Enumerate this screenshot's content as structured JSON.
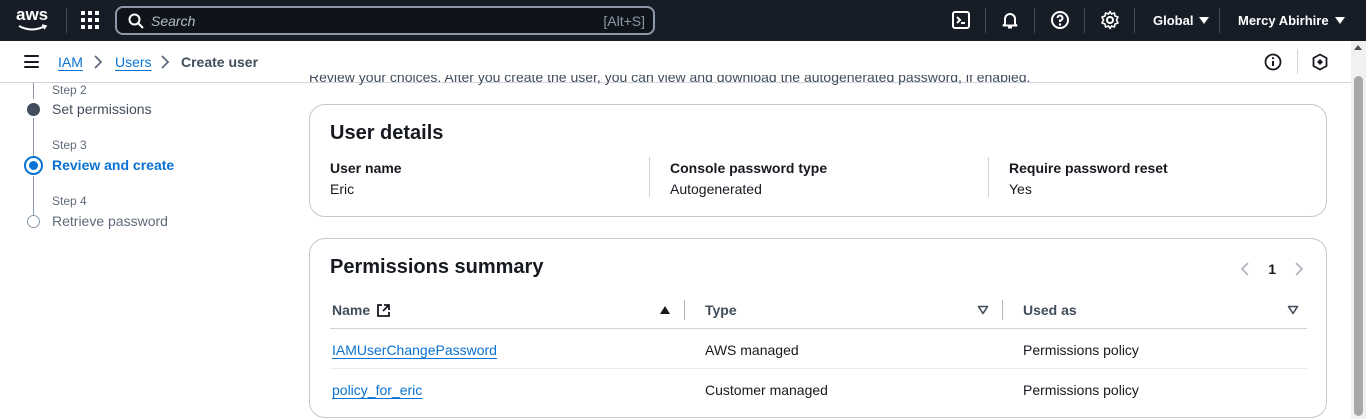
{
  "topnav": {
    "logo_text": "aws",
    "search_placeholder": "Search",
    "search_shortcut": "[Alt+S]",
    "region": "Global",
    "user": "Mercy Abirhire"
  },
  "breadcrumb": {
    "items": [
      "IAM",
      "Users"
    ],
    "current": "Create user"
  },
  "steps": [
    {
      "label": "Step 2",
      "title": "Set permissions",
      "state": "done"
    },
    {
      "label": "Step 3",
      "title": "Review and create",
      "state": "active"
    },
    {
      "label": "Step 4",
      "title": "Retrieve password",
      "state": "pending"
    }
  ],
  "cut_text": "Review your choices. After you create the user, you can view and download the autogenerated password, if enabled.",
  "user_details": {
    "title": "User details",
    "fields": [
      {
        "key": "User name",
        "value": "Eric"
      },
      {
        "key": "Console password type",
        "value": "Autogenerated"
      },
      {
        "key": "Require password reset",
        "value": "Yes"
      }
    ]
  },
  "permissions": {
    "title": "Permissions summary",
    "page": "1",
    "columns": [
      "Name",
      "Type",
      "Used as"
    ],
    "rows": [
      {
        "name": "IAMUserChangePassword",
        "type": "AWS managed",
        "used_as": "Permissions policy"
      },
      {
        "name": "policy_for_eric",
        "type": "Customer managed",
        "used_as": "Permissions policy"
      }
    ]
  },
  "colors": {
    "nav_bg": "#161d26",
    "link": "#0972d3",
    "text": "#16191f"
  }
}
